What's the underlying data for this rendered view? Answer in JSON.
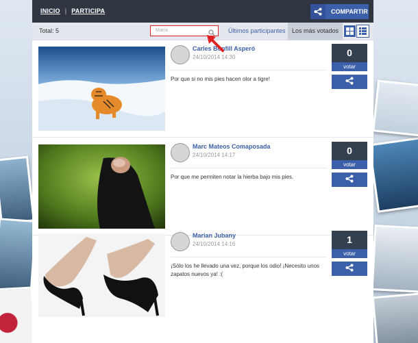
{
  "nav": {
    "home": "INICIO",
    "separator": "|",
    "participate": "PARTICIPA"
  },
  "share_button": {
    "label": "COMPARTIR"
  },
  "filter": {
    "total_label": "Total: 5",
    "search_placeholder": "María",
    "tab_latest": "Últimos participantes",
    "tab_most_voted": "Los más votados"
  },
  "posts": [
    {
      "author": "Carles Bonfill Asperó",
      "date": "24/10/2014 14:30",
      "text": "Por que si no mis pies hacen olor a tigre!",
      "votes": "0",
      "vote_label": "votar",
      "image": "tiger-in-snow"
    },
    {
      "author": "Marc Mateos Comaposada",
      "date": "24/10/2014 14:17",
      "text": "Por que me permiten notar la hierba bajo mis pies.",
      "votes": "0",
      "vote_label": "votar",
      "image": "toe-sock-on-grass"
    },
    {
      "author": "Marian Jubany",
      "date": "24/10/2014 14:16",
      "text": "¡Sólo los he llevado una vez, porque los odio! ¡Necesito unos zapatos nuevos ya! :(",
      "votes": "1",
      "vote_label": "votar",
      "image": "black-high-heels"
    }
  ],
  "colors": {
    "accent": "#3b5fa8",
    "topbar": "#2f3642",
    "highlight": "#e01f1f"
  }
}
